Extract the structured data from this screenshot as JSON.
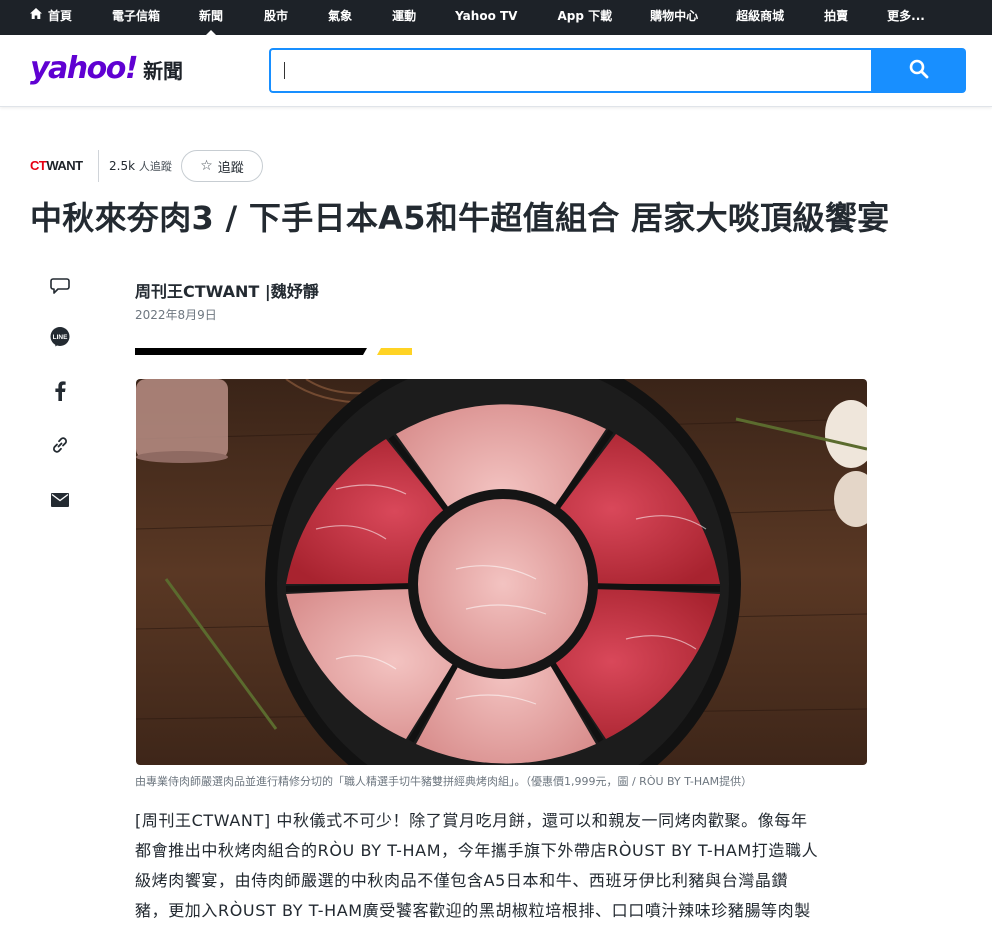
{
  "topnav": {
    "items": [
      {
        "label": "首頁",
        "active": false,
        "icon": "home-icon"
      },
      {
        "label": "電子信箱",
        "active": false
      },
      {
        "label": "新聞",
        "active": true
      },
      {
        "label": "股市",
        "active": false
      },
      {
        "label": "氣象",
        "active": false
      },
      {
        "label": "運動",
        "active": false
      },
      {
        "label": "Yahoo TV",
        "active": false
      },
      {
        "label": "App 下載",
        "active": false
      },
      {
        "label": "購物中心",
        "active": false
      },
      {
        "label": "超級商城",
        "active": false
      },
      {
        "label": "拍賣",
        "active": false
      },
      {
        "label": "更多...",
        "active": false
      }
    ]
  },
  "header": {
    "logo_text": "yahoo!",
    "section_label": "新聞",
    "search": {
      "value": "",
      "placeholder": ""
    },
    "search_button_icon": "search-icon"
  },
  "colors": {
    "brand_purple": "#6001d2",
    "search_blue": "#188fff",
    "nav_dark": "#1d2228",
    "accent_yellow": "#ffd324"
  },
  "article": {
    "provider": {
      "logo_prefix": "CT",
      "logo_suffix": "WANT",
      "follow_count": "2.5k",
      "follow_unit": "人追蹤",
      "follow_label": "追蹤"
    },
    "title": "中秋來夯肉3 / 下手日本A5和牛超值組合 居家大啖頂級饗宴",
    "byline": "周刊王CTWANT |魏妤靜",
    "date": "2022年8月9日",
    "share_icons": [
      "comment-icon",
      "line-icon",
      "facebook-icon",
      "link-icon",
      "mail-icon"
    ],
    "line_icon_text": "LINE",
    "image_caption": "由專業侍肉師嚴選肉品並進行精修分切的「職人精選手切牛豬雙拼經典烤肉組」。（優惠價1,999元，圖 / RÒU BY T-HAM提供）",
    "paragraph_lines": [
      "[周刊王CTWANT] 中秋儀式不可少！除了賞月吃月餅，還可以和親友一同烤肉歡聚。像每年",
      "都會推出中秋烤肉組合的RÒU BY T-HAM，今年攜手旗下外帶店RÒUST BY T-HAM打造職人",
      "級烤肉饗宴，由侍肉師嚴選的中秋肉品不僅包含A5日本和牛、西班牙伊比利豬與台灣晶鑽",
      "豬，更加入RÒUST BY T-HAM廣受饕客歡迎的黑胡椒粒培根排、口口噴汁辣味珍豬腸等肉製"
    ]
  }
}
